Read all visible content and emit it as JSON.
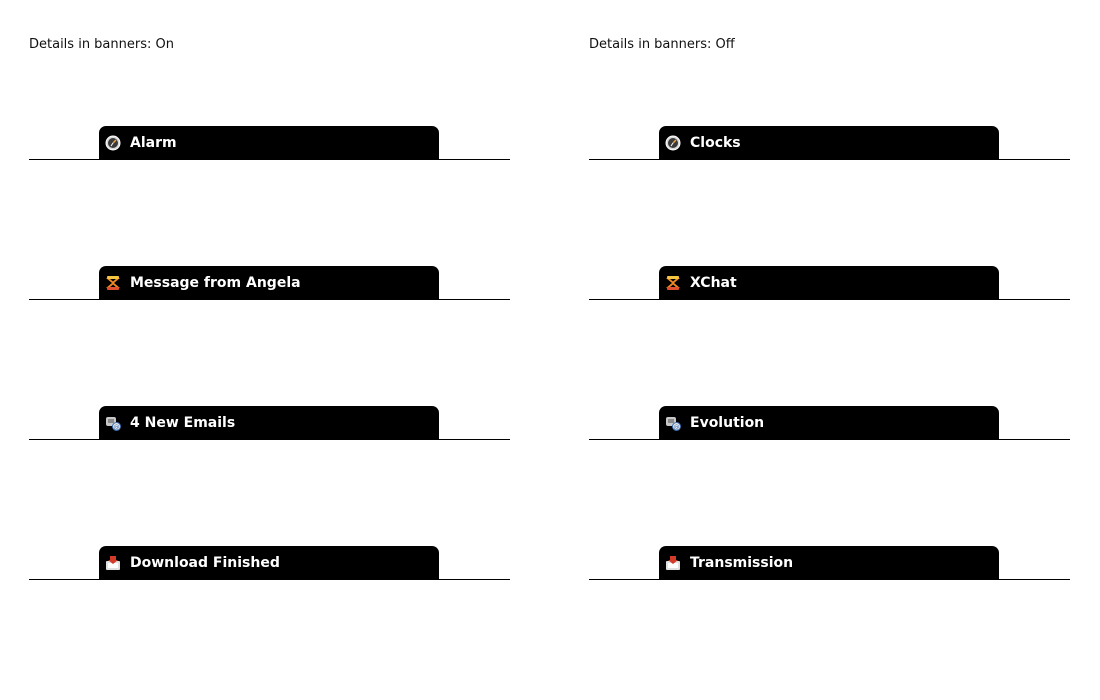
{
  "left": {
    "title": "Details in banners: On",
    "banners": [
      {
        "label": "Alarm",
        "icon": "clock-icon"
      },
      {
        "label": "Message from Angela",
        "icon": "xchat-icon"
      },
      {
        "label": "4 New Emails",
        "icon": "email-icon"
      },
      {
        "label": "Download Finished",
        "icon": "download-icon"
      }
    ]
  },
  "right": {
    "title": "Details in banners: Off",
    "banners": [
      {
        "label": "Clocks",
        "icon": "clock-icon"
      },
      {
        "label": "XChat",
        "icon": "xchat-icon"
      },
      {
        "label": "Evolution",
        "icon": "email-icon"
      },
      {
        "label": "Transmission",
        "icon": "download-icon"
      }
    ]
  },
  "colors": {
    "banner_background": "#000000",
    "banner_text": "#ffffff",
    "page_background": "#ffffff"
  }
}
